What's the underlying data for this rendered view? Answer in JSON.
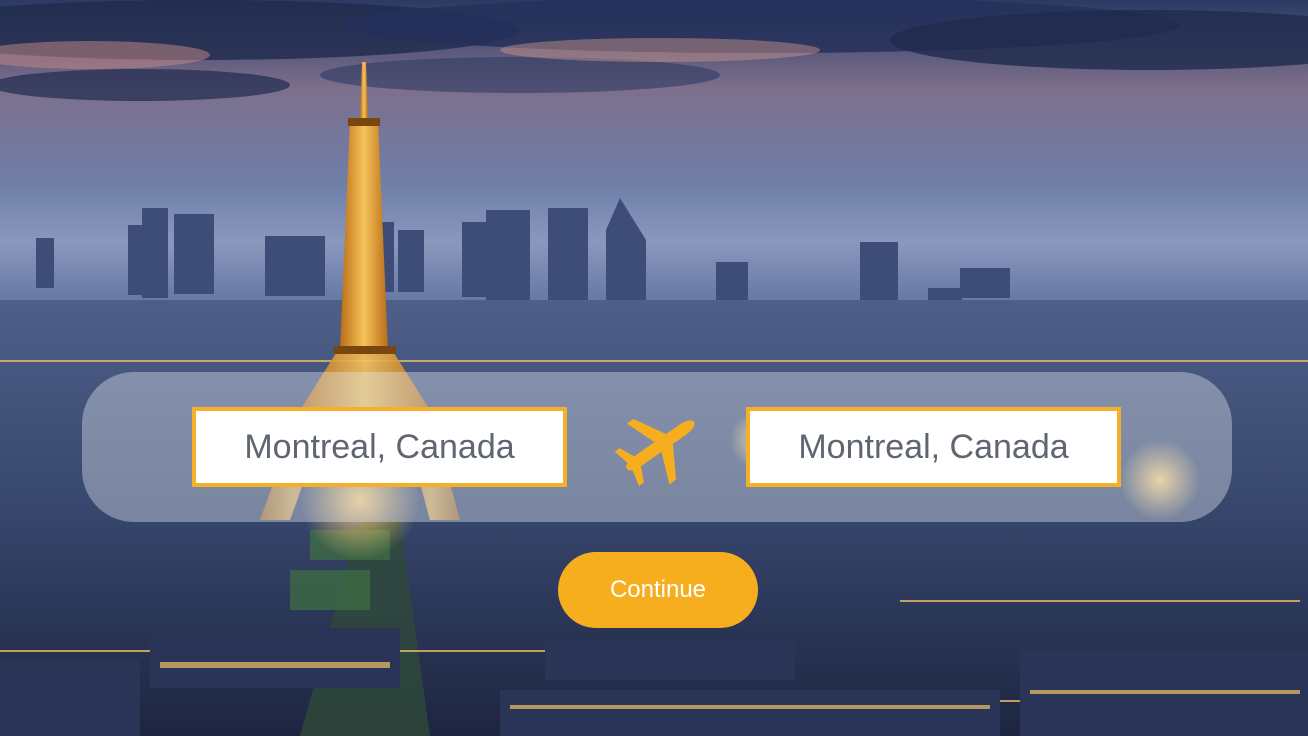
{
  "background": {
    "description_icon": "city-skyline-background"
  },
  "search": {
    "from_value": "Montreal, Canada",
    "to_value": "Montreal, Canada",
    "swap_icon": "airplane-icon"
  },
  "actions": {
    "continue_label": "Continue"
  },
  "colors": {
    "accent": "#f6ae1f",
    "field_border": "#f5b02a",
    "field_text": "#5f6670",
    "button_text": "#ffffff"
  }
}
